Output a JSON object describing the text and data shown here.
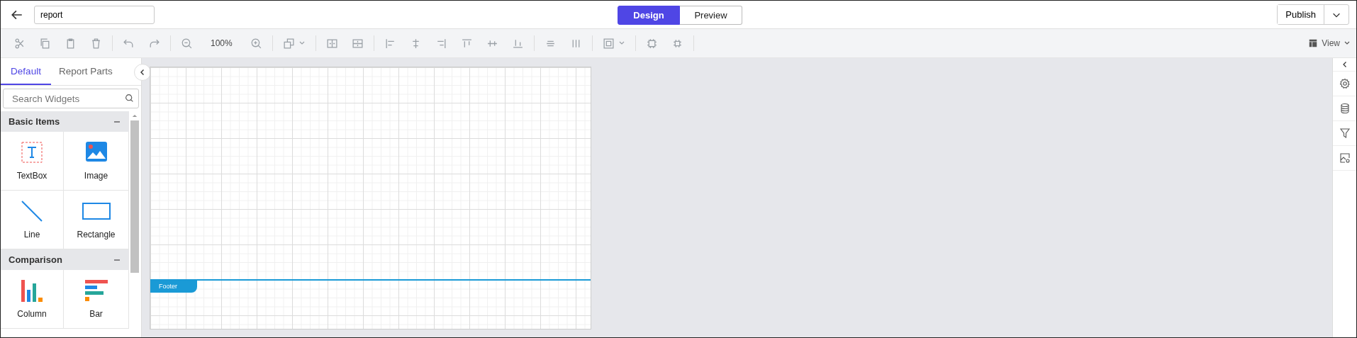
{
  "header": {
    "report_name": "report",
    "modes": [
      {
        "label": "Design",
        "selected": true
      },
      {
        "label": "Preview",
        "selected": false
      }
    ],
    "publish": "Publish"
  },
  "toolbar": {
    "zoom": "100%",
    "view": "View"
  },
  "widget_panel": {
    "tabs": [
      {
        "label": "Default",
        "selected": true
      },
      {
        "label": "Report Parts",
        "selected": false
      }
    ],
    "search": {
      "placeholder": "Search Widgets"
    },
    "sections": [
      {
        "title": "Basic Items",
        "expanded": true,
        "items": [
          {
            "label": "TextBox",
            "kind": "textbox"
          },
          {
            "label": "Image",
            "kind": "image"
          },
          {
            "label": "Line",
            "kind": "line"
          },
          {
            "label": "Rectangle",
            "kind": "rectangle"
          }
        ]
      },
      {
        "title": "Comparison",
        "expanded": true,
        "items": [
          {
            "label": "Column",
            "kind": "column"
          },
          {
            "label": "Bar",
            "kind": "bar"
          }
        ]
      }
    ]
  },
  "canvas": {
    "band": "Footer"
  }
}
